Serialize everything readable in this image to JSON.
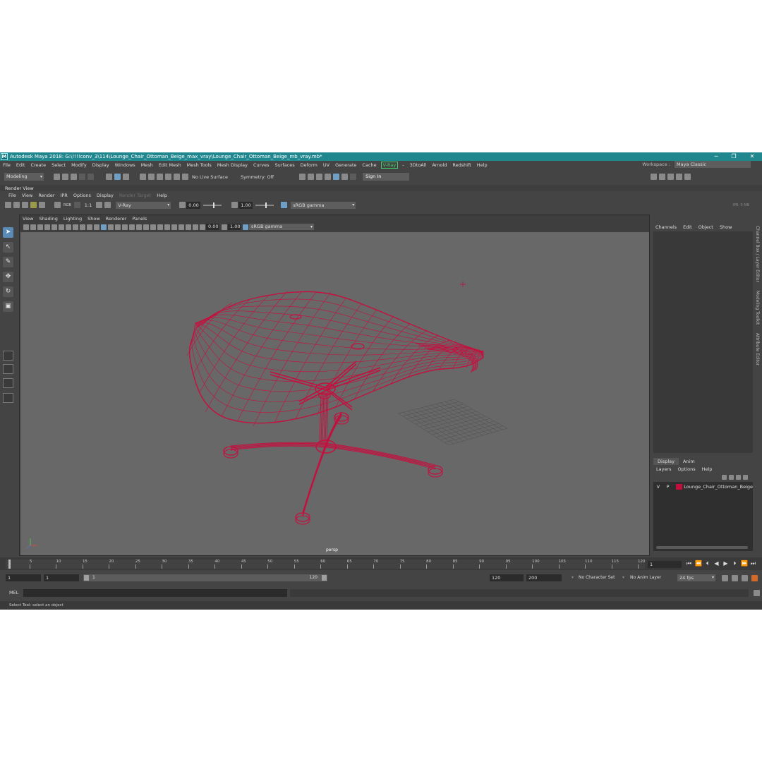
{
  "window": {
    "title": "Autodesk Maya 2018: G:\\!!!!conv_3\\114\\Lounge_Chair_Ottoman_Beige_max_vray\\Lounge_Chair_Ottoman_Beige_mb_vray.mb*",
    "minimize": "─",
    "maximize": "❐",
    "close": "✕",
    "logo": "M"
  },
  "menu": {
    "items": [
      "File",
      "Edit",
      "Create",
      "Select",
      "Modify",
      "Display",
      "Windows",
      "Mesh",
      "Edit Mesh",
      "Mesh Tools",
      "Mesh Display",
      "Curves",
      "Surfaces",
      "Deform",
      "UV",
      "Generate",
      "Cache"
    ],
    "vray": "V-Ray",
    "items2": [
      "3DtoAll",
      "Arnold",
      "Redshift",
      "Help"
    ],
    "vray_dash": "-",
    "workspace_label": "Workspace :",
    "workspace_value": "Maya Classic"
  },
  "shelf": {
    "mode": "Modeling",
    "live_surface": "No Live Surface",
    "symmetry": "Symmetry: Off",
    "sign_in": "Sign In"
  },
  "render_view": {
    "title": "Render View",
    "menu": [
      "File",
      "View",
      "Render",
      "IPR",
      "Options",
      "Display"
    ],
    "menu_disabled": "Render Target",
    "menu_help": "Help",
    "ratio": "1:1",
    "rgb": "RGB",
    "renderer": "V-Ray",
    "exposure": "0.00",
    "gamma": "1.00",
    "colorspace": "sRGB gamma",
    "ipr_label": "IPR: 0 MB"
  },
  "viewport": {
    "menu": [
      "View",
      "Shading",
      "Lighting",
      "Show",
      "Renderer",
      "Panels"
    ],
    "exposure": "0.00",
    "gamma": "1.00",
    "colorspace": "sRGB gamma",
    "camera_label": "persp",
    "wire_color": "#c5103f",
    "background": "#686868"
  },
  "channel_box": {
    "tabs": [
      "Channels",
      "Edit",
      "Object",
      "Show"
    ],
    "side_tabs": [
      "Channel Box / Layer Editor",
      "Modeling Toolkit",
      "Attribute Editor"
    ]
  },
  "layer_editor": {
    "tabs": [
      "Display",
      "Anim"
    ],
    "menu": [
      "Layers",
      "Options",
      "Help"
    ],
    "layer": {
      "v": "V",
      "p": "P",
      "name": "Lounge_Chair_Ottoman_Beige"
    },
    "layer_color": "#c00f3d"
  },
  "timeline": {
    "ticks": [
      "1",
      "5",
      "10",
      "15",
      "20",
      "25",
      "30",
      "35",
      "40",
      "45",
      "50",
      "55",
      "60",
      "65",
      "70",
      "75",
      "80",
      "85",
      "90",
      "95",
      "100",
      "105",
      "110",
      "115",
      "120"
    ],
    "current_frame": "1"
  },
  "range": {
    "start": "1",
    "anim_start": "1",
    "slider_start": "1",
    "slider_end": "120",
    "anim_end": "120",
    "end": "200",
    "character_set": "No Character Set",
    "anim_layer": "No Anim Layer",
    "fps": "24 fps"
  },
  "command": {
    "label": "MEL"
  },
  "help_line": "Select Tool: select an object"
}
